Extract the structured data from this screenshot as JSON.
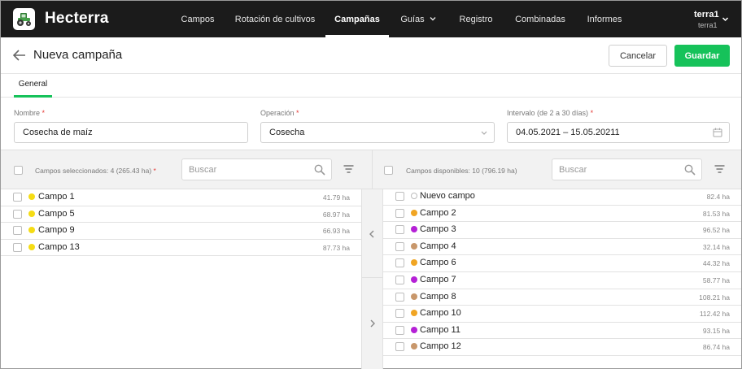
{
  "app": {
    "name": "Hecterra",
    "logo_icon": "tractor-icon"
  },
  "nav": {
    "items": [
      {
        "label": "Campos"
      },
      {
        "label": "Rotación de cultivos"
      },
      {
        "label": "Campañas",
        "active": true
      },
      {
        "label": "Guías",
        "has_dropdown": true
      },
      {
        "label": "Registro"
      },
      {
        "label": "Combinadas"
      },
      {
        "label": "Informes"
      }
    ]
  },
  "user": {
    "name": "terra1",
    "sub": "terra1"
  },
  "page": {
    "title": "Nueva campaña",
    "cancel_label": "Cancelar",
    "save_label": "Guardar"
  },
  "tabs": [
    {
      "label": "General",
      "active": true
    }
  ],
  "form": {
    "nombre": {
      "label": "Nombre",
      "required_mark": "*",
      "value": "Cosecha de maíz"
    },
    "operacion": {
      "label": "Operación",
      "required_mark": "*",
      "value": "Cosecha"
    },
    "intervalo": {
      "label": "Intervalo (de 2 a 30 días)",
      "required_mark": "*",
      "value": "04.05.2021 – 15.05.20211"
    }
  },
  "selected_panel": {
    "summary": "Campos seleccionados: 4 (265.43 ha)",
    "required_mark": "*",
    "search_placeholder": "Buscar",
    "rows": [
      {
        "name": "Campo 1",
        "area": "41.79 ha",
        "color": "#f5dc14"
      },
      {
        "name": "Campo 5",
        "area": "68.97 ha",
        "color": "#f5dc14"
      },
      {
        "name": "Campo 9",
        "area": "66.93 ha",
        "color": "#f5dc14"
      },
      {
        "name": "Campo 13",
        "area": "87.73 ha",
        "color": "#f5dc14"
      }
    ]
  },
  "available_panel": {
    "summary": "Campos disponibles: 10 (796.19 ha)",
    "search_placeholder": "Buscar",
    "rows": [
      {
        "name": "Nuevo campo",
        "area": "82.4 ha",
        "color": "none"
      },
      {
        "name": "Campo 2",
        "area": "81.53 ha",
        "color": "#f0a524"
      },
      {
        "name": "Campo 3",
        "area": "96.52 ha",
        "color": "#b521d6"
      },
      {
        "name": "Campo 4",
        "area": "32.14 ha",
        "color": "#c8976b"
      },
      {
        "name": "Campo 6",
        "area": "44.32 ha",
        "color": "#f0a524"
      },
      {
        "name": "Campo 7",
        "area": "58.77 ha",
        "color": "#b521d6"
      },
      {
        "name": "Campo 8",
        "area": "108.21 ha",
        "color": "#c8976b"
      },
      {
        "name": "Campo 10",
        "area": "112.42 ha",
        "color": "#f0a524"
      },
      {
        "name": "Campo 11",
        "area": "93.15 ha",
        "color": "#b521d6"
      },
      {
        "name": "Campo 12",
        "area": "86.74 ha",
        "color": "#c8976b"
      }
    ]
  },
  "colors": {
    "accent": "#16c25a",
    "topbar": "#1b1b1b",
    "required": "#e53935"
  }
}
